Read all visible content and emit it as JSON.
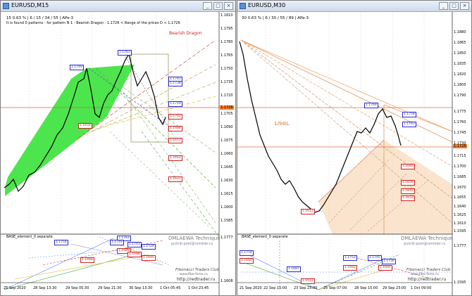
{
  "left": {
    "title": "EURUSD,M15",
    "info1": "15  0.63 %  |  6 / 15 / 34 / 55  |  APe-3",
    "info2": "It is found 0 patterns  -  for pattern N 1 - Bearish Dragon  -  1.1726 < Range of the prices D < 1.1726",
    "pattern": "Bearish Dragon",
    "indicator": "BASE_element_0 separate",
    "price_labels": [
      "1.1810",
      "1.1795",
      "1.1780",
      "1.1765",
      "1.1750",
      "1.1735",
      "1.1720",
      "1.1705",
      "1.1690",
      "1.1675",
      "1.1660",
      "1.1645",
      "1.1630",
      "1.1615",
      "1.1600",
      "1.1585"
    ],
    "current_price": "1.1726",
    "sub_axis": [
      "1.1777",
      "1.1608"
    ],
    "time_labels": [
      "25 Sep 2020",
      "28 Sep 13:30",
      "29 Sep 05:30",
      "29 Sep 21:30",
      "30 Sep 13:30",
      "1 Oct 05:45",
      "1 Oct 23:45"
    ],
    "chart_labels": {
      "h1": "1.1763",
      "h2": "1.1749",
      "h3": "1.1743",
      "h4": "1.1738",
      "h5": "1.1719",
      "r1": "1.1702",
      "r2": "1.1688",
      "r3": "1.1673",
      "r4": "1.1652",
      "r5": "1.1637",
      "l1": "1.1658"
    },
    "sub_labels": {
      "a": "1.1754",
      "b": "1.1763",
      "c": "1.1749",
      "d": "1.1743",
      "e": "1.1724",
      "f": "1.1689",
      "g": "1.1688",
      "h": "1.1688",
      "i": "1.1695"
    },
    "watermark": {
      "title": "DMLAEWA Technique",
      "email": "putnik-post@rambler.ru",
      "club": "Fibonacci Traders Club",
      "site": "www.fibo-forex.ru",
      "url": "http://redtrader.ru"
    }
  },
  "right": {
    "title": "EURUSD,M30",
    "info1": "30  0.63 %  |  6 / 30 / 55 / 89  |  APe-3",
    "indicator": "BASE_element_0 separate",
    "fibo_label": "1/94IL",
    "price_labels": [
      "1.1880",
      "1.1865",
      "1.1850",
      "1.1835",
      "1.1820",
      "1.1805",
      "1.1790",
      "1.1775",
      "1.1760",
      "1.1745",
      "1.1730",
      "1.1715",
      "1.1700",
      "1.1685",
      "1.1670",
      "1.1655",
      "1.1640",
      "1.1625",
      "1.1610",
      "1.1595"
    ],
    "current_price": "1.1726",
    "sub_axis": [
      "1.1777",
      "1.1595"
    ],
    "time_labels": [
      "21 Sep 2020",
      "22 Sep 15:00",
      "23 Sep 23:00",
      "25 Sep 07:00",
      "28 Sep 15:00",
      "29 Sep 23:00",
      "1 Oct 09:00"
    ],
    "chart_labels": {
      "h1": "1.1769",
      "b1": "1.1758",
      "b2": "1.1743",
      "r1": "1.1685",
      "r2": "1.1656",
      "r3": "1.1642",
      "r4": "1.1633",
      "low": "1.1612"
    },
    "sub_labels": {
      "a": "1.1774",
      "b": "1.1753",
      "c": "1.1687",
      "d": "1.1692",
      "e": "1.1745",
      "f": "1.1736",
      "g": "1.1695",
      "h": "1.1640",
      "i": "1.1612"
    },
    "watermark": {
      "title": "DMLAEWA Technique",
      "email": "putnik-post@rambler.ru",
      "club": "Fibonacci Traders Club",
      "site": "www.fibo-forex.ru",
      "url": "http://redtrader.ru"
    }
  },
  "window_buttons": {
    "min": "_",
    "max": "□",
    "close": "×"
  }
}
